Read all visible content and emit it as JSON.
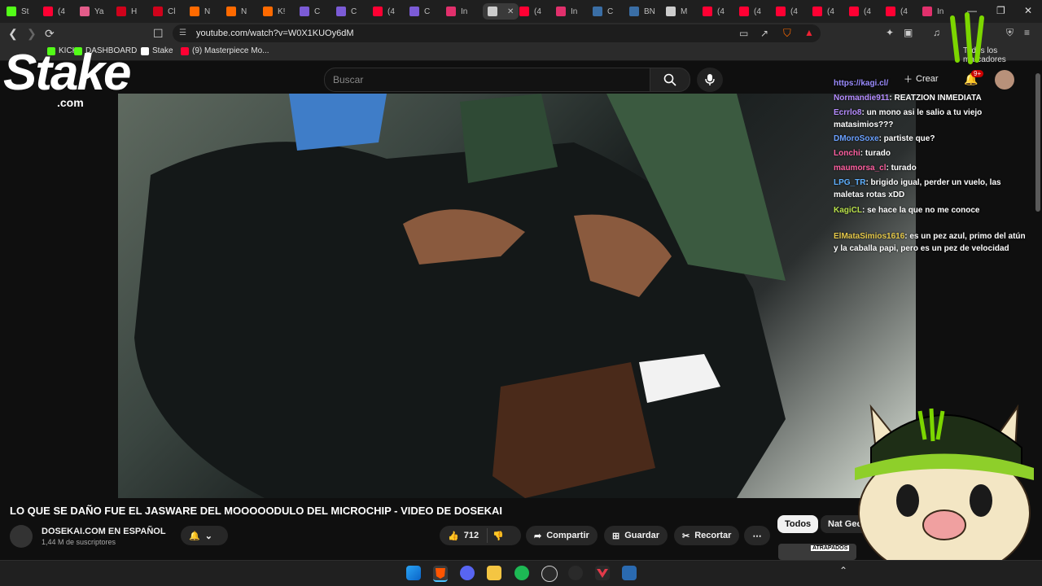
{
  "browser": {
    "tabs": [
      {
        "label": "St",
        "color": "#53fc18"
      },
      {
        "label": "(4",
        "color": "#ff0033"
      },
      {
        "label": "Ya",
        "color": "#e35c8a"
      },
      {
        "label": "H",
        "color": "#d0021b"
      },
      {
        "label": "Cl",
        "color": "#d0021b"
      },
      {
        "label": "N",
        "color": "#ff6a00"
      },
      {
        "label": "N",
        "color": "#ff6a00"
      },
      {
        "label": "K!",
        "color": "#ff6a00"
      },
      {
        "label": "C",
        "color": "#7b5bd6"
      },
      {
        "label": "C",
        "color": "#7b5bd6"
      },
      {
        "label": "(4",
        "color": "#ff0033"
      },
      {
        "label": "C",
        "color": "#7b5bd6"
      },
      {
        "label": "In",
        "color": "#e1306c"
      },
      {
        "label": "",
        "color": "#cccccc",
        "active": true
      },
      {
        "label": "(4",
        "color": "#ff0033"
      },
      {
        "label": "In",
        "color": "#e1306c"
      },
      {
        "label": "C",
        "color": "#3a6ea5"
      },
      {
        "label": "BN",
        "color": "#3a6ea5"
      },
      {
        "label": "M",
        "color": "#cccccc"
      },
      {
        "label": "(4",
        "color": "#ff0033"
      },
      {
        "label": "(4",
        "color": "#ff0033"
      },
      {
        "label": "(4",
        "color": "#ff0033"
      },
      {
        "label": "(4",
        "color": "#ff0033"
      },
      {
        "label": "(4",
        "color": "#ff0033"
      },
      {
        "label": "(4",
        "color": "#ff0033"
      },
      {
        "label": "In",
        "color": "#e1306c"
      }
    ],
    "url": "youtube.com/watch?v=W0X1KUOy6dM",
    "bookmarks": [
      {
        "label": "KICK",
        "color": "#53fc18"
      },
      {
        "label": "DASHBOARD",
        "color": "#53fc18"
      },
      {
        "label": "Stake",
        "color": "#ffffff"
      },
      {
        "label": "(9) Masterpiece Mo...",
        "color": "#ff0033"
      }
    ],
    "all_bookmarks": "Todos los marcadores"
  },
  "youtube": {
    "search_placeholder": "Buscar",
    "create_label": "Crear",
    "notif_count": "9+",
    "video_title": "LO QUE SE DAÑO FUE EL JASWARE DEL MOOOOODULO DEL MICROCHIP - VIDEO DE DOSEKAI",
    "channel_name": "DOSEKAI.COM EN ESPAÑOL",
    "subscribers": "1,44 M de suscriptores",
    "likes": "712",
    "share_label": "Compartir",
    "save_label": "Guardar",
    "clip_label": "Recortar",
    "chips": [
      "Todos",
      "Nat Geo"
    ],
    "thumb_text": "ATRAPADOS"
  },
  "overlay": {
    "logo_text": "Stake",
    "logo_sub": ".com"
  },
  "chat": [
    {
      "user": "https://kagi.cl/",
      "msg": "",
      "color": "#9b8cff"
    },
    {
      "user": "Normandie911",
      "msg": ": REATZION INMEDIATA",
      "color": "#b58cff"
    },
    {
      "user": "Ecrrlo8",
      "msg": ": un mono asi le salio a tu viejo matasimios???",
      "color": "#b58cff"
    },
    {
      "user": "DMoroSoxe",
      "msg": ": partiste que?",
      "color": "#6aa0ff"
    },
    {
      "user": "Lonchi",
      "msg": ": turado",
      "color": "#ff5fa0"
    },
    {
      "user": "maumorsa_cl",
      "msg": ": turado",
      "color": "#ff5fa0"
    },
    {
      "user": "LPG_TR",
      "msg": ": brigido igual, perder un vuelo, las maletas rotas xDD",
      "color": "#5fb0ff"
    },
    {
      "user": "KagiCL",
      "msg": ": se hace la que no me conoce",
      "color": "#b8e04a"
    },
    {
      "user": "ElMataSimios1616",
      "msg": ": es un pez azul, primo del atún y la caballa papi, pero es un pez de velocidad",
      "color": "#e6c94a"
    }
  ],
  "colors": {
    "accent": "#53fc18",
    "youtube_red": "#ff0033"
  }
}
